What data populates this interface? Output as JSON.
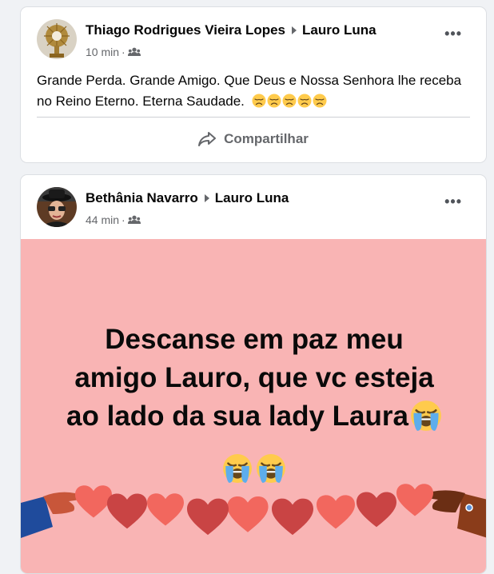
{
  "posts": [
    {
      "author": "Thiago Rodrigues Vieira Lopes",
      "target": "Lauro Luna",
      "time": "10 min",
      "privacy_icon": "group-icon",
      "text": "Grande Perda. Grande Amigo. Que Deus e Nossa Senhora lhe receba no Reino Eterno. Eterna Saudade.",
      "emojis": [
        "disappointed-face",
        "disappointed-face",
        "disappointed-face",
        "disappointed-face",
        "disappointed-face"
      ],
      "share_label": "Compartilhar"
    },
    {
      "author": "Bethânia Navarro",
      "target": "Lauro Luna",
      "time": "44 min",
      "privacy_icon": "group-icon",
      "image": {
        "background": "#f9b4b4",
        "lines": [
          "Descanse em paz meu",
          "amigo Lauro, que vc esteja",
          "ao lado da sua lady Laura"
        ],
        "emojis": [
          "loudly-crying-face",
          "loudly-crying-face",
          "loudly-crying-face"
        ]
      }
    }
  ],
  "ui": {
    "more_label": "•••",
    "meta_separator": "·"
  },
  "colors": {
    "card_bg": "#ffffff",
    "page_bg": "#f0f2f5",
    "secondary_text": "#65676b",
    "image_bg": "#f9b4b4",
    "heart_red": "#c94444",
    "heart_coral": "#f2675e"
  }
}
